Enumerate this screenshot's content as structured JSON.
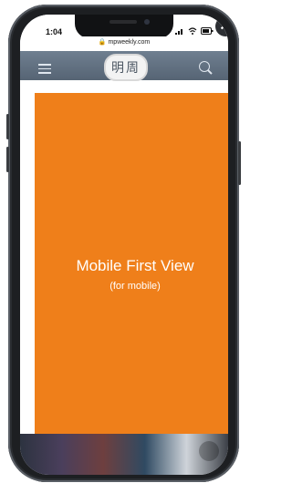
{
  "status": {
    "time": "1:04"
  },
  "browser": {
    "url": "mpweekly.com"
  },
  "site": {
    "logo": "明周"
  },
  "ad": {
    "title": "Mobile First View",
    "subtitle": "(for mobile)"
  },
  "icons": {
    "close_symbol": "✕"
  },
  "colors": {
    "ad_bg": "#ef7f1a",
    "nav_bg": "#6f7f90"
  }
}
